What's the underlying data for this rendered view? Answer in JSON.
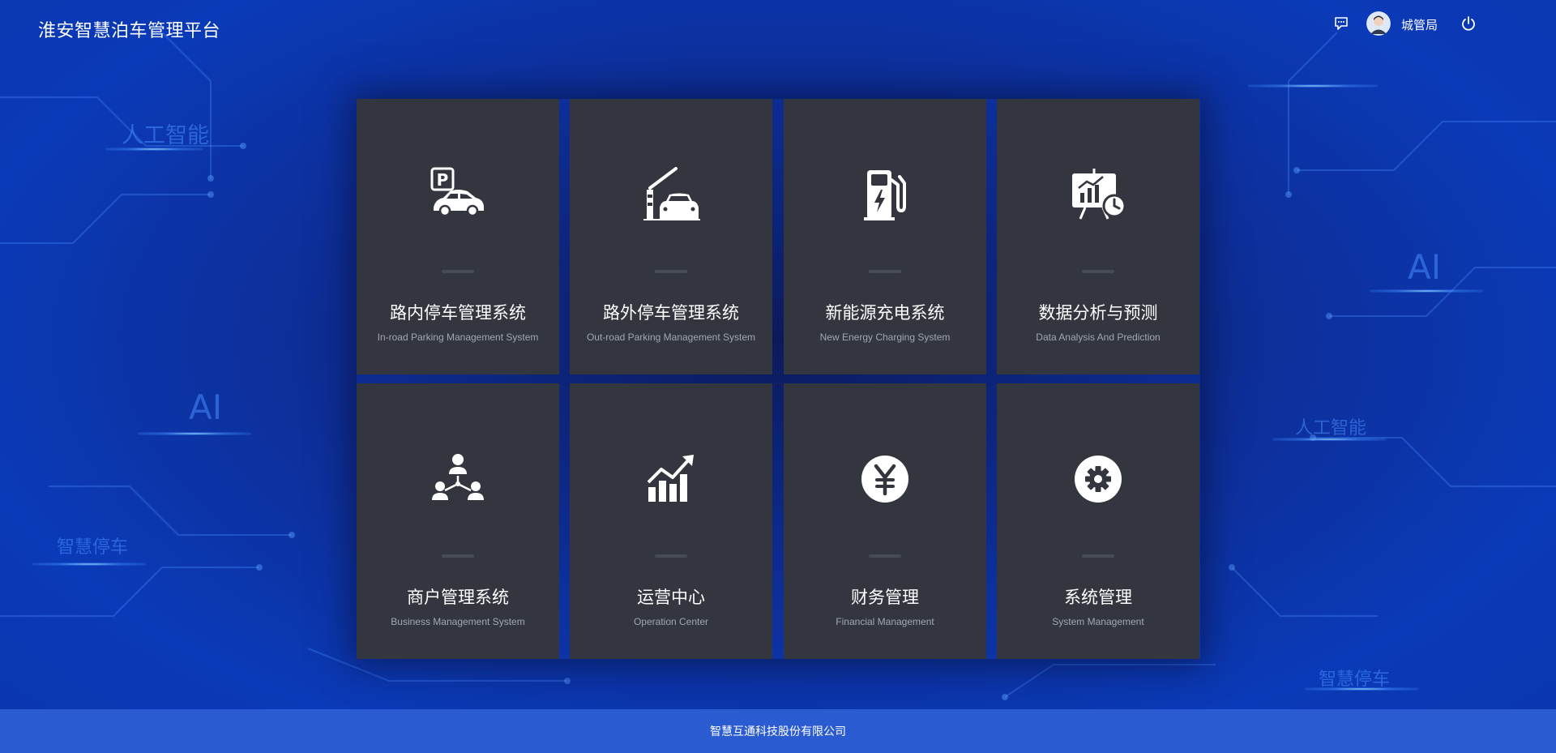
{
  "header": {
    "title": "淮安智慧泊车管理平台",
    "user_name": "城管局",
    "icons": {
      "message": "message-icon",
      "avatar": "avatar",
      "power": "power-icon"
    }
  },
  "background_words": [
    "人工智能",
    "AI",
    "智慧停车",
    "AI",
    "人工智能",
    "智慧停车"
  ],
  "modules": [
    {
      "title": "路内停车管理系统",
      "subtitle": "In-road Parking Management System",
      "icon": "parking-car-icon"
    },
    {
      "title": "路外停车管理系统",
      "subtitle": "Out-road Parking Management System",
      "icon": "barrier-gate-icon"
    },
    {
      "title": "新能源充电系统",
      "subtitle": "New Energy Charging System",
      "icon": "charging-station-icon"
    },
    {
      "title": "数据分析与预测",
      "subtitle": "Data Analysis And Prediction",
      "icon": "presentation-chart-icon"
    },
    {
      "title": "商户管理系统",
      "subtitle": "Business Management System",
      "icon": "users-network-icon"
    },
    {
      "title": "运营中心",
      "subtitle": "Operation Center",
      "icon": "growth-chart-icon"
    },
    {
      "title": "财务管理",
      "subtitle": "Financial Management",
      "icon": "yen-icon"
    },
    {
      "title": "系统管理",
      "subtitle": "System Management",
      "icon": "gear-icon"
    }
  ],
  "footer": {
    "text": "智慧互通科技股份有限公司"
  },
  "colors": {
    "background": "#0d2f9a",
    "card": "#33363f",
    "card_subtitle": "#a3a7ae",
    "footer": "#2b5bd1"
  }
}
